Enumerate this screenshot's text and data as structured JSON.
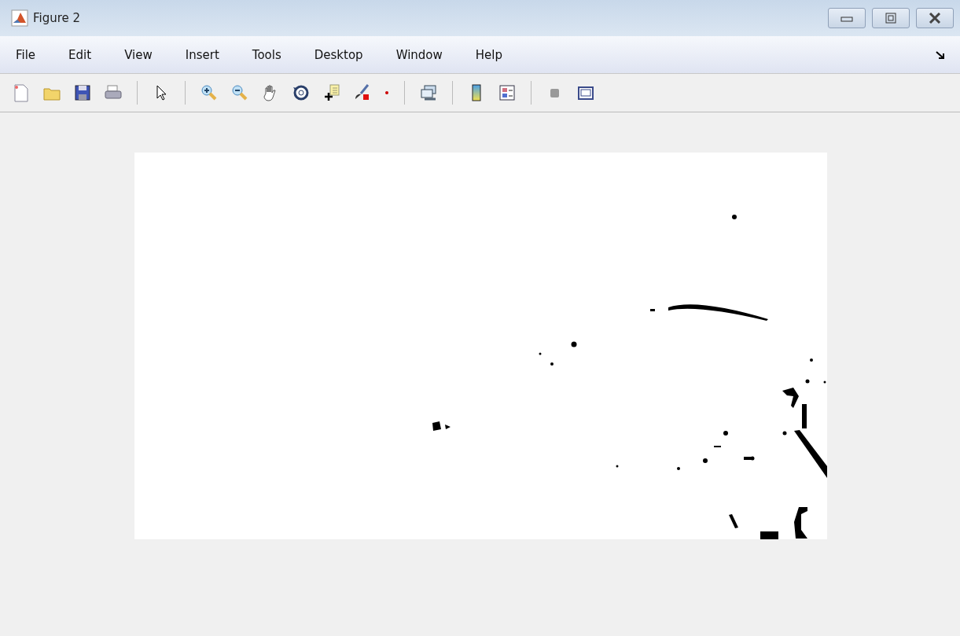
{
  "window": {
    "title": "Figure 2"
  },
  "menu": [
    {
      "label": "File"
    },
    {
      "label": "Edit"
    },
    {
      "label": "View"
    },
    {
      "label": "Insert"
    },
    {
      "label": "Tools"
    },
    {
      "label": "Desktop"
    },
    {
      "label": "Window"
    },
    {
      "label": "Help"
    }
  ]
}
